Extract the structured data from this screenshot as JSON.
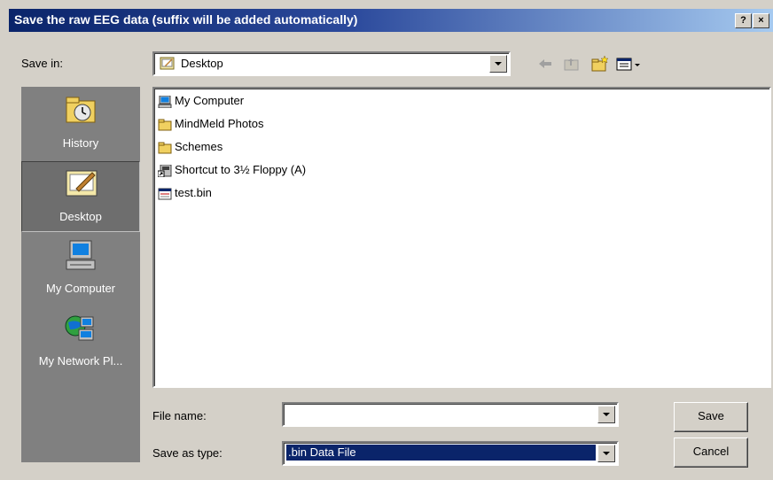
{
  "window": {
    "title": "Save the raw EEG data (suffix will be added automatically)"
  },
  "titlebar": {
    "help": "?",
    "close": "×"
  },
  "save_in": {
    "label": "Save in:",
    "value": "Desktop"
  },
  "places": [
    {
      "label": "History",
      "icon": "history-icon"
    },
    {
      "label": "Desktop",
      "icon": "desktop-icon"
    },
    {
      "label": "My Computer",
      "icon": "my-computer-icon"
    },
    {
      "label": "My Network Pl...",
      "icon": "network-places-icon"
    }
  ],
  "files": [
    {
      "name": "My Computer",
      "icon": "my-computer-icon"
    },
    {
      "name": "MindMeld Photos",
      "icon": "folder-icon"
    },
    {
      "name": "Schemes",
      "icon": "folder-icon"
    },
    {
      "name": "Shortcut to 3½ Floppy (A)",
      "icon": "shortcut-icon"
    },
    {
      "name": "test.bin",
      "icon": "file-icon"
    }
  ],
  "file_name": {
    "label": "File name:",
    "value": ""
  },
  "save_as_type": {
    "label": "Save as type:",
    "value": ".bin Data File"
  },
  "buttons": {
    "save": "Save",
    "cancel": "Cancel"
  },
  "colors": {
    "titlebar": "#0a246a",
    "selection": "#0a246a",
    "dialog": "#d4d0c8"
  }
}
